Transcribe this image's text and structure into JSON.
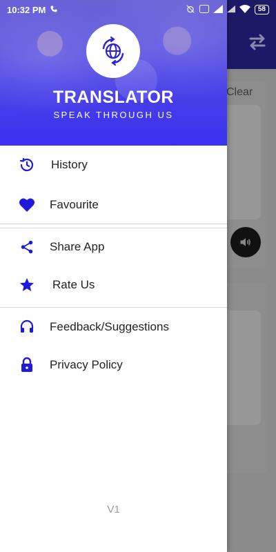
{
  "status_bar": {
    "time": "10:32 PM",
    "battery": "58"
  },
  "background_app": {
    "clear_label": "Clear"
  },
  "drawer": {
    "title": "TRANSLATOR",
    "subtitle": "SPEAK THROUGH US",
    "menu": [
      {
        "label": "History",
        "icon": "history-icon"
      },
      {
        "label": "Favourite",
        "icon": "heart-icon"
      },
      {
        "label": "Share App",
        "icon": "share-icon"
      },
      {
        "label": "Rate Us",
        "icon": "star-icon"
      },
      {
        "label": "Feedback/Suggestions",
        "icon": "headset-icon"
      },
      {
        "label": "Privacy Policy",
        "icon": "lock-icon"
      }
    ],
    "version": "V1"
  },
  "colors": {
    "accent": "#1f1ad8",
    "header_gradient_start": "#6a63d6",
    "header_gradient_end": "#3b31f0"
  }
}
